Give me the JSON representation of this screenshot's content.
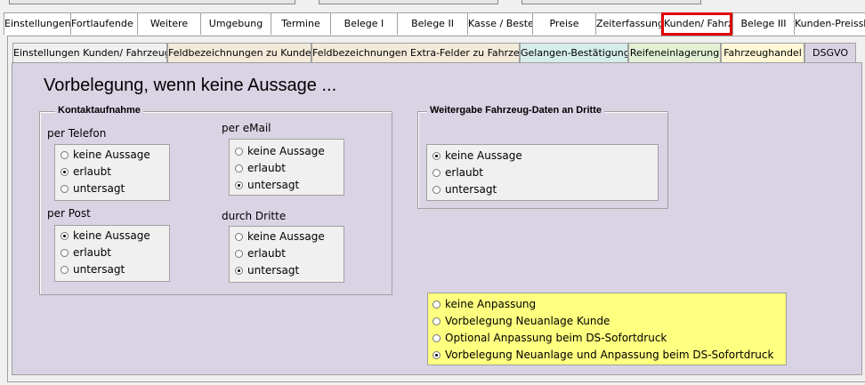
{
  "main_tabs": [
    {
      "label": "Einstellungen"
    },
    {
      "label": "Fortlaufende N"
    },
    {
      "label": "Weitere"
    },
    {
      "label": "Umgebung"
    },
    {
      "label": "Termine"
    },
    {
      "label": "Belege I"
    },
    {
      "label": "Belege II"
    },
    {
      "label": "Kasse / Beste"
    },
    {
      "label": "Preise"
    },
    {
      "label": "Zeiterfassung"
    },
    {
      "label": "Kunden/ Fahrz"
    },
    {
      "label": "Belege III"
    },
    {
      "label": "Kunden-Preissl"
    }
  ],
  "sub_tabs": [
    {
      "label": "Einstellungen Kunden/ Fahrzeuge"
    },
    {
      "label": "Feldbezeichnungen zu Kunde"
    },
    {
      "label": "Feldbezeichnungen Extra-Felder zu Fahrzeug"
    },
    {
      "label": "Gelangen-Bestätigung"
    },
    {
      "label": "Reifeneinlagerung"
    },
    {
      "label": "Fahrzeughandel"
    },
    {
      "label": "DSGVO"
    }
  ],
  "colors": {
    "panel": "#d9d3e4",
    "highlight": "#e00000",
    "yellow": "#ffff80",
    "tab_beige": "#f3ead9",
    "tab_cyan": "#d6eeea",
    "tab_green": "#e3f0d4",
    "tab_yellow": "#fff7d6"
  },
  "heading": "Vorbelegung, wenn keine Aussage ...",
  "kontakt": {
    "legend": "Kontaktaufnahme",
    "telefon": {
      "label": "per Telefon",
      "options": [
        "keine Aussage",
        "erlaubt",
        "untersagt"
      ],
      "selected": 1
    },
    "email": {
      "label": "per eMail",
      "options": [
        "keine Aussage",
        "erlaubt",
        "untersagt"
      ],
      "selected": 2
    },
    "post": {
      "label": "per Post",
      "options": [
        "keine Aussage",
        "erlaubt",
        "untersagt"
      ],
      "selected": 0
    },
    "dritte": {
      "label": "durch Dritte",
      "options": [
        "keine Aussage",
        "erlaubt",
        "untersagt"
      ],
      "selected": 2
    }
  },
  "weitergabe": {
    "legend": "Weitergabe Fahrzeug-Daten an Dritte",
    "options": [
      "keine Aussage",
      "erlaubt",
      "untersagt"
    ],
    "selected": 0
  },
  "anpassung": {
    "options": [
      "keine Anpassung",
      "Vorbelegung Neuanlage Kunde",
      "Optional Anpassung beim DS-Sofortdruck",
      "Vorbelegung Neuanlage und Anpassung beim DS-Sofortdruck"
    ],
    "selected": 3
  }
}
